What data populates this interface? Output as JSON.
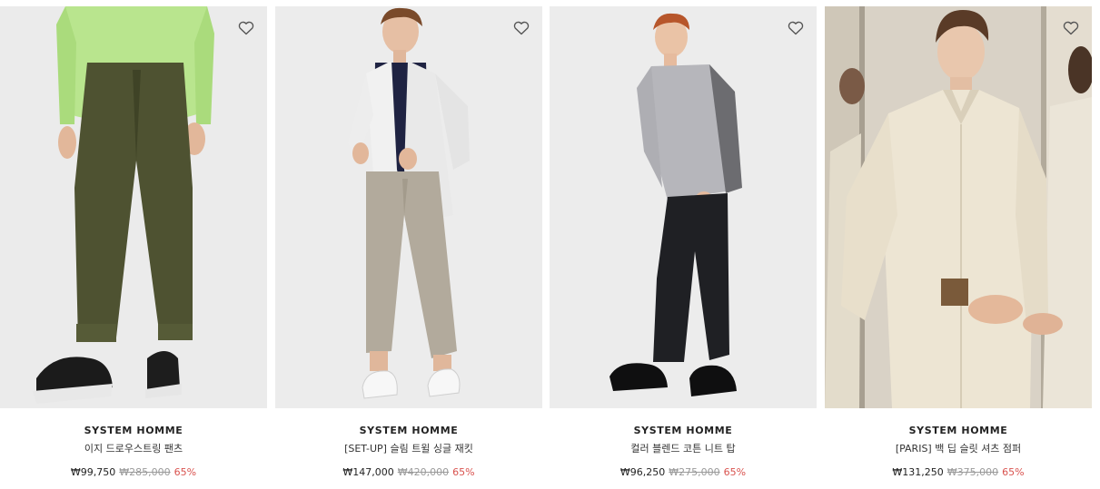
{
  "products": [
    {
      "brand": "SYSTEM HOMME",
      "name": "이지 드로우스트링 팬츠",
      "price": "₩99,750",
      "original_price": "₩285,000",
      "discount": "65%",
      "wishlist_icon": "heart-outline-icon",
      "wishlisted": false
    },
    {
      "brand": "SYSTEM HOMME",
      "name": "[SET-UP] 슬림 트윌 싱글 재킷",
      "price": "₩147,000",
      "original_price": "₩420,000",
      "discount": "65%",
      "wishlist_icon": "heart-outline-icon",
      "wishlisted": false
    },
    {
      "brand": "SYSTEM HOMME",
      "name": "컬러 블렌드 코튼 니트 탑",
      "price": "₩96,250",
      "original_price": "₩275,000",
      "discount": "65%",
      "wishlist_icon": "heart-outline-icon",
      "wishlisted": false
    },
    {
      "brand": "SYSTEM HOMME",
      "name": "[PARIS] 백 딥 슬릿 셔츠 점퍼",
      "price": "₩131,250",
      "original_price": "₩375,000",
      "discount": "65%",
      "wishlist_icon": "heart-outline-icon",
      "wishlisted": false
    }
  ],
  "colors": {
    "discount": "#d9534f",
    "original_price": "#9a9a9a",
    "photo_background": "#ececec"
  }
}
